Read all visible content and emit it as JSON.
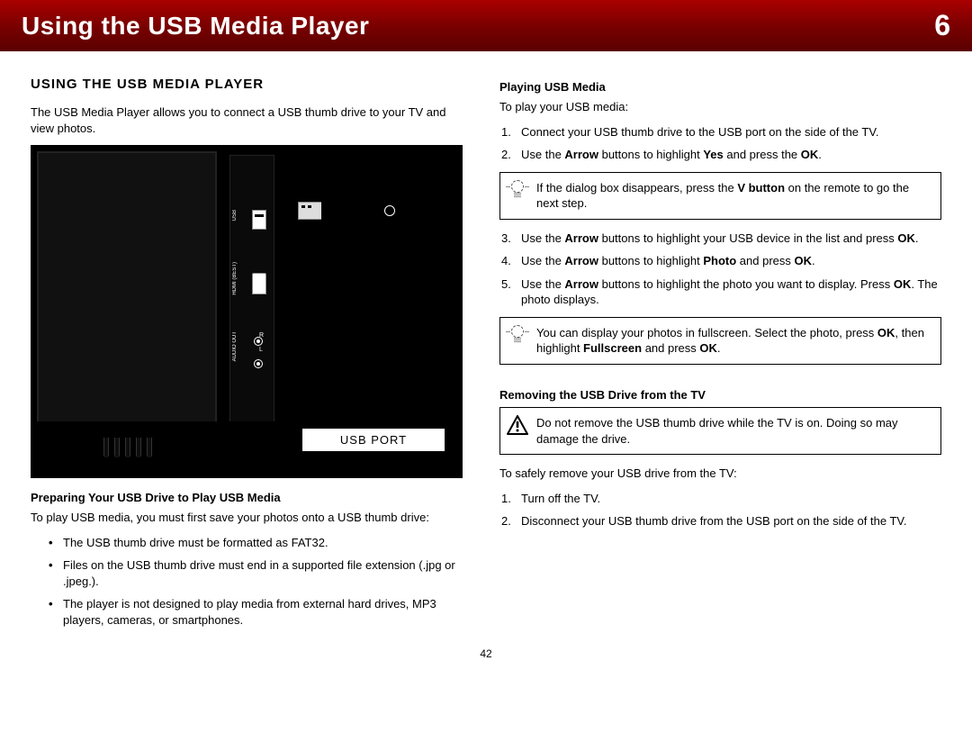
{
  "header": {
    "title": "Using the USB Media Player",
    "chapter": "6"
  },
  "left": {
    "h2": "USING THE USB MEDIA PLAYER",
    "intro": "The USB Media Player allows you to connect a USB thumb drive to your TV and view photos.",
    "port_label": "USB PORT",
    "prep_h": "Preparing Your USB Drive to Play USB Media",
    "prep_p": "To play USB media, you must first save your photos onto a USB thumb drive:",
    "bul1": "The USB thumb drive must be formatted as FAT32.",
    "bul2": "Files on the USB thumb drive must end in a supported file extension (.jpg or .jpeg.).",
    "bul3": "The player is not designed to play media from external hard drives, MP3 players, cameras, or smartphones."
  },
  "right": {
    "play_h": "Playing USB Media",
    "play_p": "To play your USB media:",
    "s1": "Connect your USB thumb drive to the USB port on the side of the TV.",
    "s2a": "Use the ",
    "s2b": "Arrow",
    "s2c": " buttons to highlight ",
    "s2d": "Yes",
    "s2e": " and press the ",
    "s2f": "OK",
    "s2g": ".",
    "tip1a": "If the dialog box disappears, press the ",
    "tip1b": "V button",
    "tip1c": " on the remote to go the next step.",
    "s3a": "Use the ",
    "s3b": "Arrow",
    "s3c": " buttons to highlight your USB device in the list and press ",
    "s3d": "OK",
    "s3e": ".",
    "s4a": "Use the ",
    "s4b": "Arrow",
    "s4c": " buttons to highlight ",
    "s4d": "Photo",
    "s4e": " and press ",
    "s4f": "OK",
    "s4g": ".",
    "s5a": "Use the ",
    "s5b": "Arrow",
    "s5c": " buttons to highlight the photo you want to display. Press ",
    "s5d": "OK",
    "s5e": ". The photo displays.",
    "tip2a": "You can display your photos in fullscreen. Select the photo, press ",
    "tip2b": "OK",
    "tip2c": ", then highlight ",
    "tip2d": "Fullscreen",
    "tip2e": " and press ",
    "tip2f": "OK",
    "tip2g": ".",
    "rem_h": "Removing the USB Drive from the TV",
    "warn": "Do not remove the USB thumb drive while the TV is on. Doing so may damage the drive.",
    "rem_p": "To safely remove your USB drive from the TV:",
    "r1": "Turn off the TV.",
    "r2": "Disconnect your USB thumb drive from the USB port on the side of the TV."
  },
  "page_num": "42"
}
